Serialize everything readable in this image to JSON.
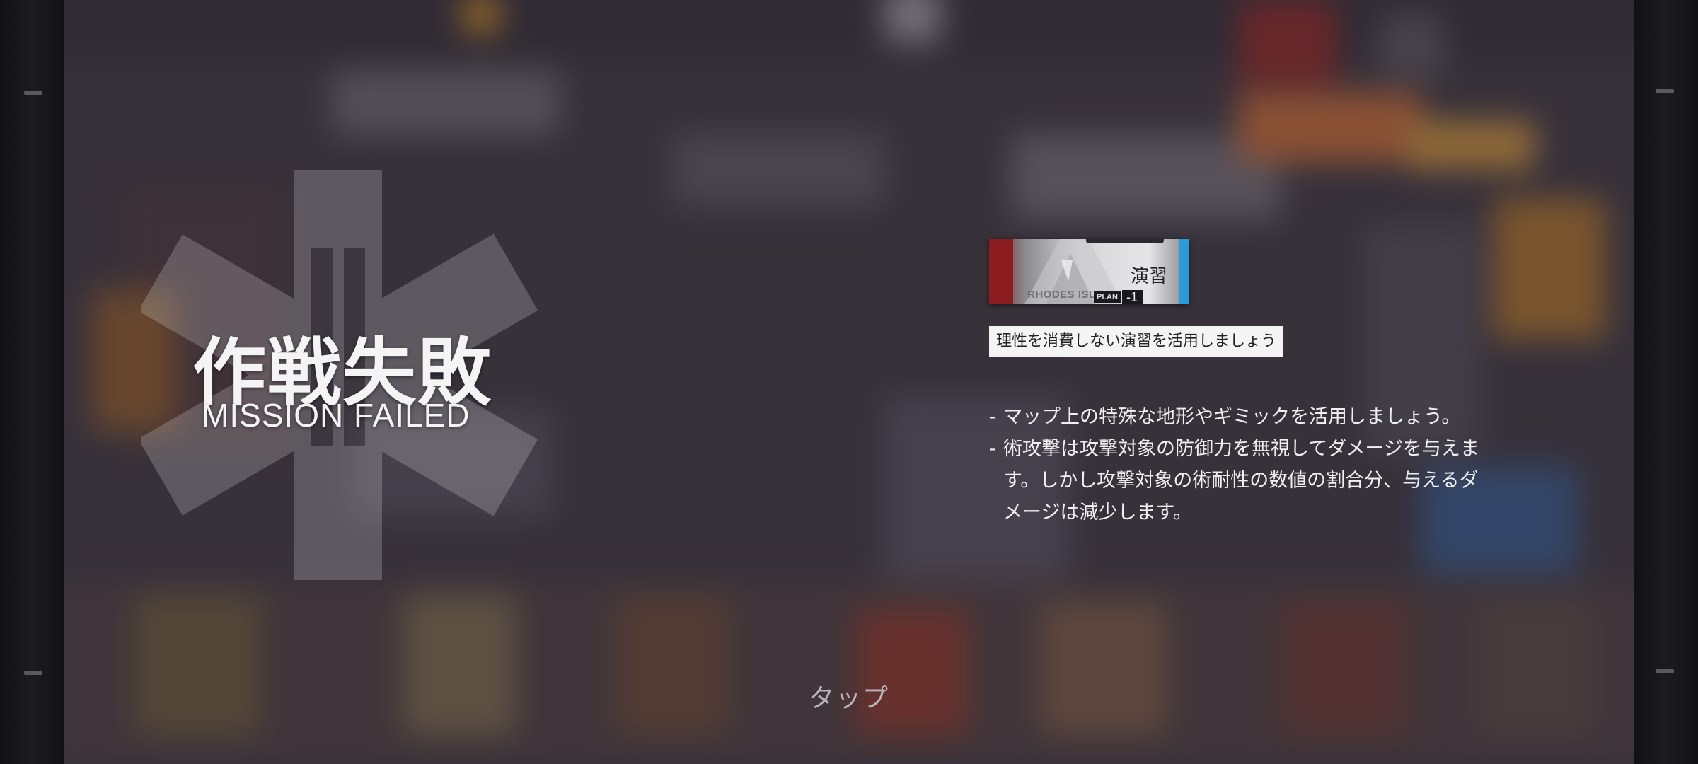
{
  "result": {
    "title_jp": "作戦失敗",
    "title_en": "MISSION FAILED"
  },
  "practice_card": {
    "label": "演習",
    "watermark_text": "RHODES ISLAN",
    "plan_label": "PLAN",
    "plan_cost": "-1"
  },
  "practice_hint": "理性を消費しない演習を活用しましょう",
  "tips": [
    "マップ上の特殊な地形やギミックを活用しましょう。",
    "術攻撃は攻撃対象の防御力を無視してダメージを与えます。しかし攻撃対象の術耐性の数値の割合分、与えるダメージは減少します。"
  ],
  "tip_prefix": "-",
  "tap_prompt": "タップ",
  "colors": {
    "accent_red": "#8b1d20",
    "accent_blue": "#2a9ad8",
    "title_text": "#f4f4f4",
    "tap_text": "#b8b4bc"
  }
}
